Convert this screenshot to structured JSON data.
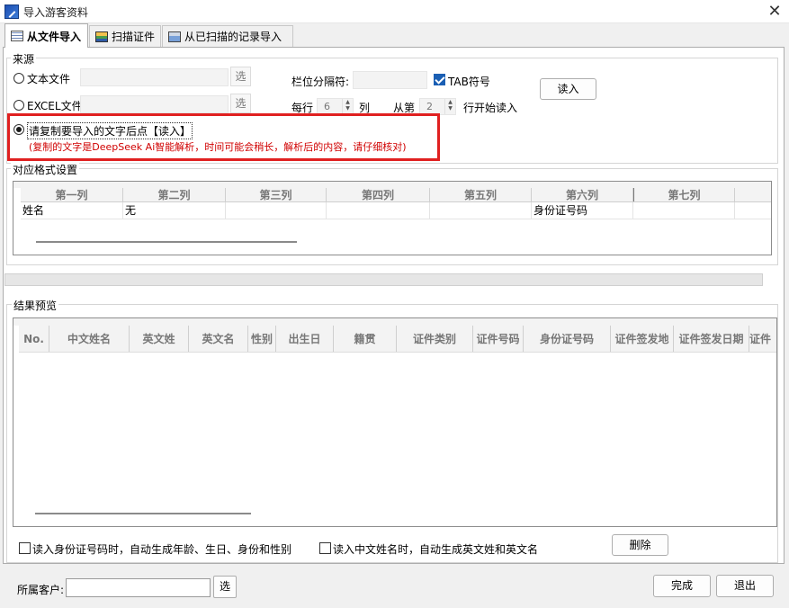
{
  "window": {
    "title": "导入游客资料",
    "close": "✕"
  },
  "tabs": [
    {
      "label": "从文件导入"
    },
    {
      "label": "扫描证件"
    },
    {
      "label": "从已扫描的记录导入"
    }
  ],
  "source": {
    "group_label": "来源",
    "text_file_label": "文本文件",
    "excel_file_label": "EXCEL文件",
    "choose_label": "选",
    "separator_label": "栏位分隔符:",
    "tab_checkbox_label": "TAB符号",
    "read_button": "读入",
    "per_row_label": "每行",
    "per_row_value": "6",
    "col_label": "列",
    "from_label": "从第",
    "from_value": "2",
    "start_row_label": "行开始读入",
    "paste_option_label": "请复制要导入的文字后点【读入】",
    "paste_note": "(复制的文字是DeepSeek Ai智能解析，时间可能会稍长，解析后的内容，请仔细核对)"
  },
  "mapping": {
    "group_label": "对应格式设置",
    "headers": [
      "第一列",
      "第二列",
      "第三列",
      "第四列",
      "第五列",
      "第六列",
      "第七列"
    ],
    "row": [
      "姓名",
      "无",
      "",
      "",
      "",
      "身份证号码",
      ""
    ]
  },
  "preview": {
    "group_label": "结果预览",
    "headers": [
      "No.",
      "中文姓名",
      "英文姓",
      "英文名",
      "性别",
      "出生日",
      "籍贯",
      "证件类别",
      "证件号码",
      "身份证号码",
      "证件签发地",
      "证件签发日期",
      "证件"
    ]
  },
  "options": {
    "auto_id_label": "读入身份证号码时，自动生成年龄、生日、身份和性别",
    "auto_name_label": "读入中文姓名时，自动生成英文姓和英文名",
    "delete_button": "删除"
  },
  "footer": {
    "customer_label": "所属客户:",
    "customer_value": "",
    "choose_label": "选",
    "finish_button": "完成",
    "exit_button": "退出"
  },
  "colors": {
    "highlight_border": "#e02020",
    "note_text": "#d00000",
    "checkbox_accent": "#1a5fb4"
  }
}
